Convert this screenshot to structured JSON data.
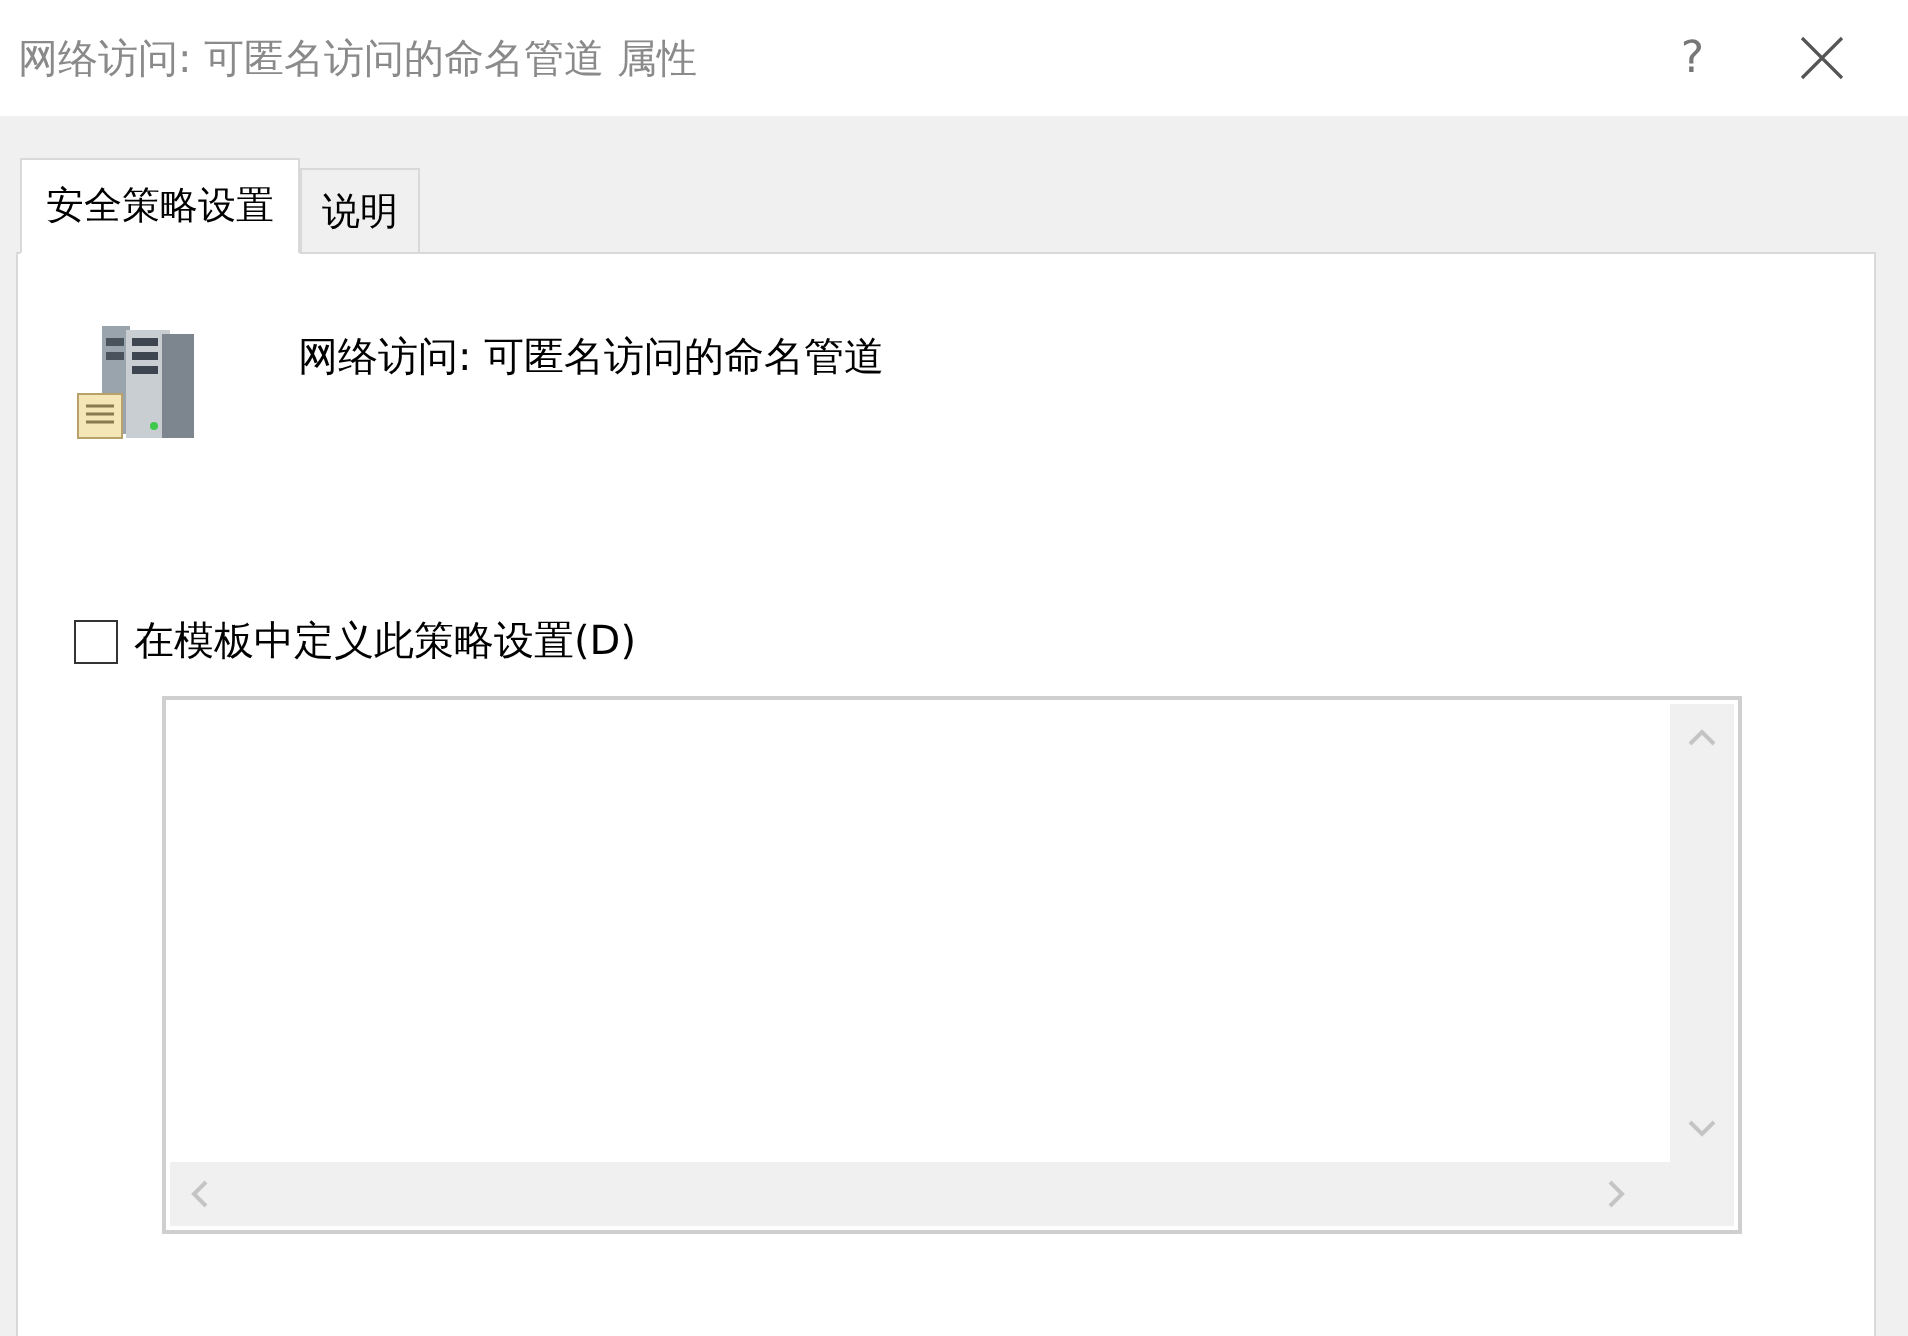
{
  "window": {
    "title": "网络访问: 可匿名访问的命名管道 属性",
    "help": "?"
  },
  "tabs": [
    {
      "label": "安全策略设置",
      "selected": true
    },
    {
      "label": "说明",
      "selected": false
    }
  ],
  "policy": {
    "name": "网络访问: 可匿名访问的命名管道"
  },
  "define_checkbox": {
    "label": "在模板中定义此策略设置(D)",
    "checked": false
  }
}
